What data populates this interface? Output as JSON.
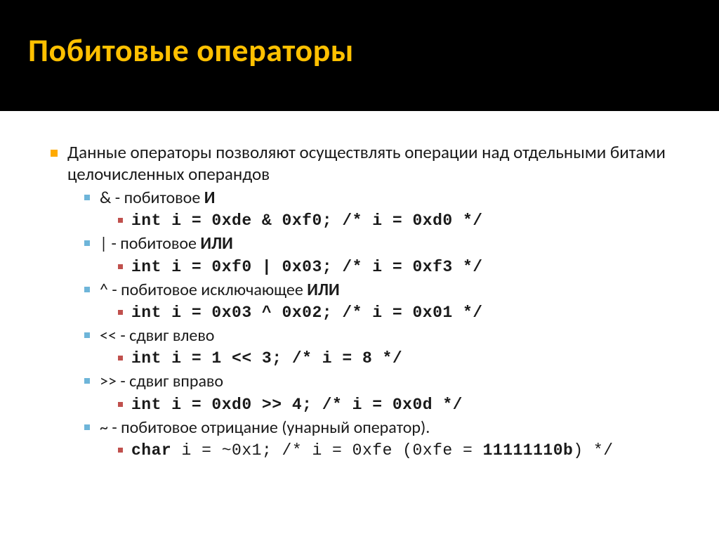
{
  "title": "Побитовые операторы",
  "intro": "Данные операторы позволяют осуществлять операции над отдельными битами целочисленных операндов",
  "ops": [
    {
      "sym": "&",
      "desc_prefix": " - побитовое ",
      "desc_bold": "И",
      "desc_suffix": "",
      "code": "int i = 0xde & 0xf0; /* i = 0xd0 */"
    },
    {
      "sym": "|",
      "desc_prefix": " - побитовое ",
      "desc_bold": "ИЛИ",
      "desc_suffix": "",
      "code": "int i = 0xf0 | 0x03; /* i = 0xf3 */"
    },
    {
      "sym": "^",
      "desc_prefix": " - побитовое исключающее ",
      "desc_bold": "ИЛИ",
      "desc_suffix": "",
      "code": "int i = 0x03 ^ 0x02; /* i = 0x01 */"
    },
    {
      "sym": "<<",
      "desc_prefix": " - сдвиг влево",
      "desc_bold": "",
      "desc_suffix": "",
      "code": "int i = 1 << 3; /* i = 8 */"
    },
    {
      "sym": ">>",
      "desc_prefix": " - сдвиг вправо",
      "desc_bold": "",
      "desc_suffix": "",
      "code": "int i = 0xd0 >> 4; /* i = 0x0d */"
    },
    {
      "sym": "~",
      "desc_prefix": " - побитовое отрицание (унарный оператор).",
      "desc_bold": "",
      "desc_suffix": "",
      "code_kw": "char",
      "code_rest": " i = ~0x1; /* i = 0xfe (0xfe = ",
      "code_bold": "11111110b",
      "code_tail": ") */"
    }
  ]
}
